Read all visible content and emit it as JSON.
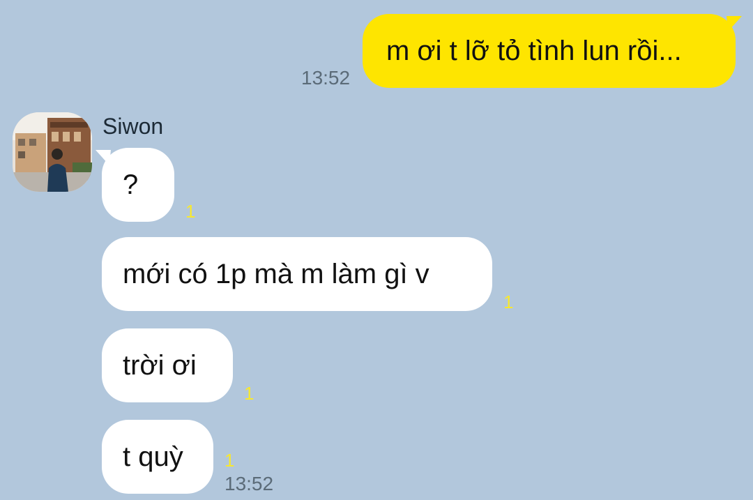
{
  "chat": {
    "outgoing": {
      "text": "m ơi t lỡ tỏ tình lun rồi...",
      "time": "13:52"
    },
    "sender": {
      "name": "Siwon",
      "avatar_icon": "profile-photo"
    },
    "incoming": [
      {
        "text": "?",
        "unread": "1"
      },
      {
        "text": "mới có 1p mà m làm gì v",
        "unread": "1"
      },
      {
        "text": "trời ơi",
        "unread": "1"
      },
      {
        "text": "t quỳ",
        "unread": "1"
      }
    ],
    "incoming_time": "13:52"
  },
  "colors": {
    "background": "#b2c7dc",
    "outgoing_bubble": "#fee500",
    "incoming_bubble": "#ffffff",
    "unread_count": "#f8e82e",
    "timestamp": "#5b6b78"
  }
}
